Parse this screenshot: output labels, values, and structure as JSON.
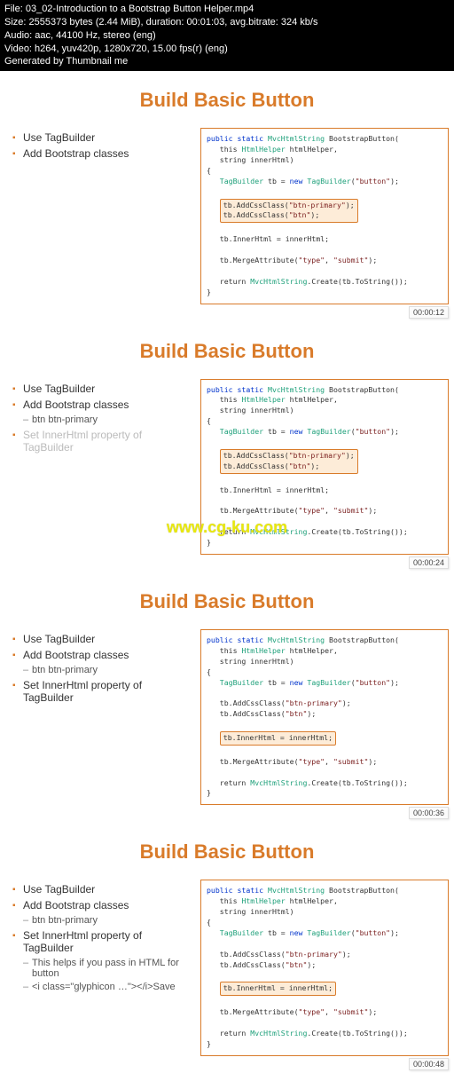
{
  "header": {
    "file_line": "File: 03_02-Introduction to a Bootstrap Button Helper.mp4",
    "size_line": "Size: 2555373 bytes (2.44 MiB), duration: 00:01:03, avg.bitrate: 324 kb/s",
    "audio_line": "Audio: aac, 44100 Hz, stereo (eng)",
    "video_line": "Video: h264, yuv420p, 1280x720, 15.00 fps(r) (eng)",
    "generated_line": "Generated by Thumbnail me"
  },
  "slide_title": "Build Basic Button",
  "bullets": {
    "b1": "Use TagBuilder",
    "b2": "Add Bootstrap classes",
    "b2_sub": "btn btn-primary",
    "b3": "Set InnerHtml property of TagBuilder",
    "b3_sub1": "This helps if you pass in HTML for button",
    "b3_sub2": "<i class=\"glyphicon …\"></i>Save"
  },
  "code": {
    "sig1": "public static ",
    "sig2": " BootstrapButton(",
    "sig3": "   this ",
    "sig4": " htmlHelper,",
    "sig5": "   string innerHtml)",
    "open": "{",
    "tb_decl1": "   ",
    "tb_decl2": " tb = ",
    "tb_decl3": " ",
    "tb_decl4": "(",
    "tb_decl5": ");",
    "addcss1": "tb.AddCssClass(",
    "addcss2": ");",
    "addcss3": "tb.AddCssClass(",
    "addcss4": ");",
    "inner_plain": "   tb.InnerHtml = innerHtml;",
    "inner_hl": "tb.InnerHtml = innerHtml;",
    "merge1": "   tb.MergeAttribute(",
    "merge2": ", ",
    "merge3": ");",
    "ret1": "   return ",
    "ret2": ".Create(tb.ToString());",
    "close": "}",
    "t_MvcHtmlString": "MvcHtmlString",
    "t_HtmlHelper": "HtmlHelper",
    "t_TagBuilder": "TagBuilder",
    "kw_new": "new",
    "s_button": "\"button\"",
    "s_btnprimary": "\"btn-primary\"",
    "s_btn": "\"btn\"",
    "s_type": "\"type\"",
    "s_submit": "\"submit\""
  },
  "timestamps": {
    "t1": "00:00:12",
    "t2": "00:00:24",
    "t3": "00:00:36",
    "t4": "00:00:48"
  },
  "watermark": "www.cg-ku.com"
}
